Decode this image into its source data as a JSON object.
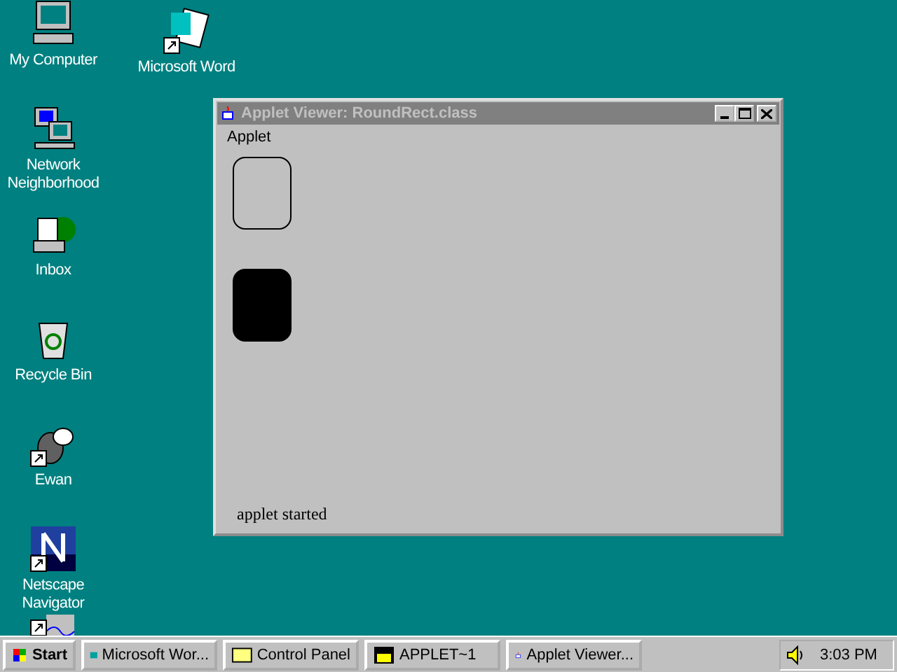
{
  "desktop_icons": [
    {
      "label": "My Computer",
      "kind": "computer",
      "shortcut": false
    },
    {
      "label": "Microsoft Word",
      "kind": "word",
      "shortcut": true
    },
    {
      "label": "Network Neighborhood",
      "kind": "network",
      "shortcut": false
    },
    {
      "label": "Inbox",
      "kind": "inbox",
      "shortcut": false
    },
    {
      "label": "Recycle Bin",
      "kind": "recycle",
      "shortcut": false
    },
    {
      "label": "Ewan",
      "kind": "mic",
      "shortcut": true
    },
    {
      "label": "Netscape Navigator",
      "kind": "netscape",
      "shortcut": true
    },
    {
      "kind": "partial",
      "shortcut": true
    }
  ],
  "window": {
    "title": "Applet Viewer: RoundRect.class",
    "active": false,
    "menu": [
      "Applet"
    ],
    "shapes": [
      {
        "kind": "outline"
      },
      {
        "kind": "filled"
      }
    ],
    "status": "applet started"
  },
  "taskbar": {
    "start": "Start",
    "buttons": [
      {
        "label": "Microsoft Wor...",
        "kind": "word",
        "selected": false
      },
      {
        "label": "Control Panel",
        "kind": "control",
        "selected": false
      },
      {
        "label": "APPLET~1",
        "kind": "dos",
        "selected": false
      },
      {
        "label": "Applet Viewer...",
        "kind": "java",
        "selected": false
      }
    ],
    "clock": "3:03 PM"
  }
}
